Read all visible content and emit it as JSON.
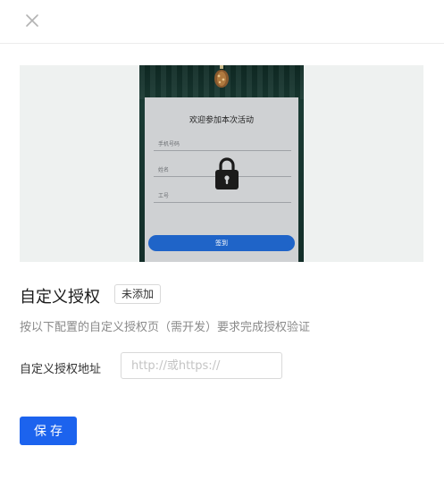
{
  "header": {
    "close_icon": "close-icon"
  },
  "preview": {
    "phone_title": "欢迎参加本次活动",
    "fields": [
      "手机号码",
      "姓名",
      "工号"
    ],
    "submit_label": "签到",
    "lock_icon": "lock-icon",
    "button_color": "#1f64c8"
  },
  "auth": {
    "title": "自定义授权",
    "status": "未添加",
    "description": "按以下配置的自定义授权页（需开发）要求完成授权验证",
    "url_label": "自定义授权地址",
    "url_value": "",
    "url_placeholder": "http://或https://"
  },
  "actions": {
    "save_label": "保存",
    "accent": "#1c63ee"
  }
}
